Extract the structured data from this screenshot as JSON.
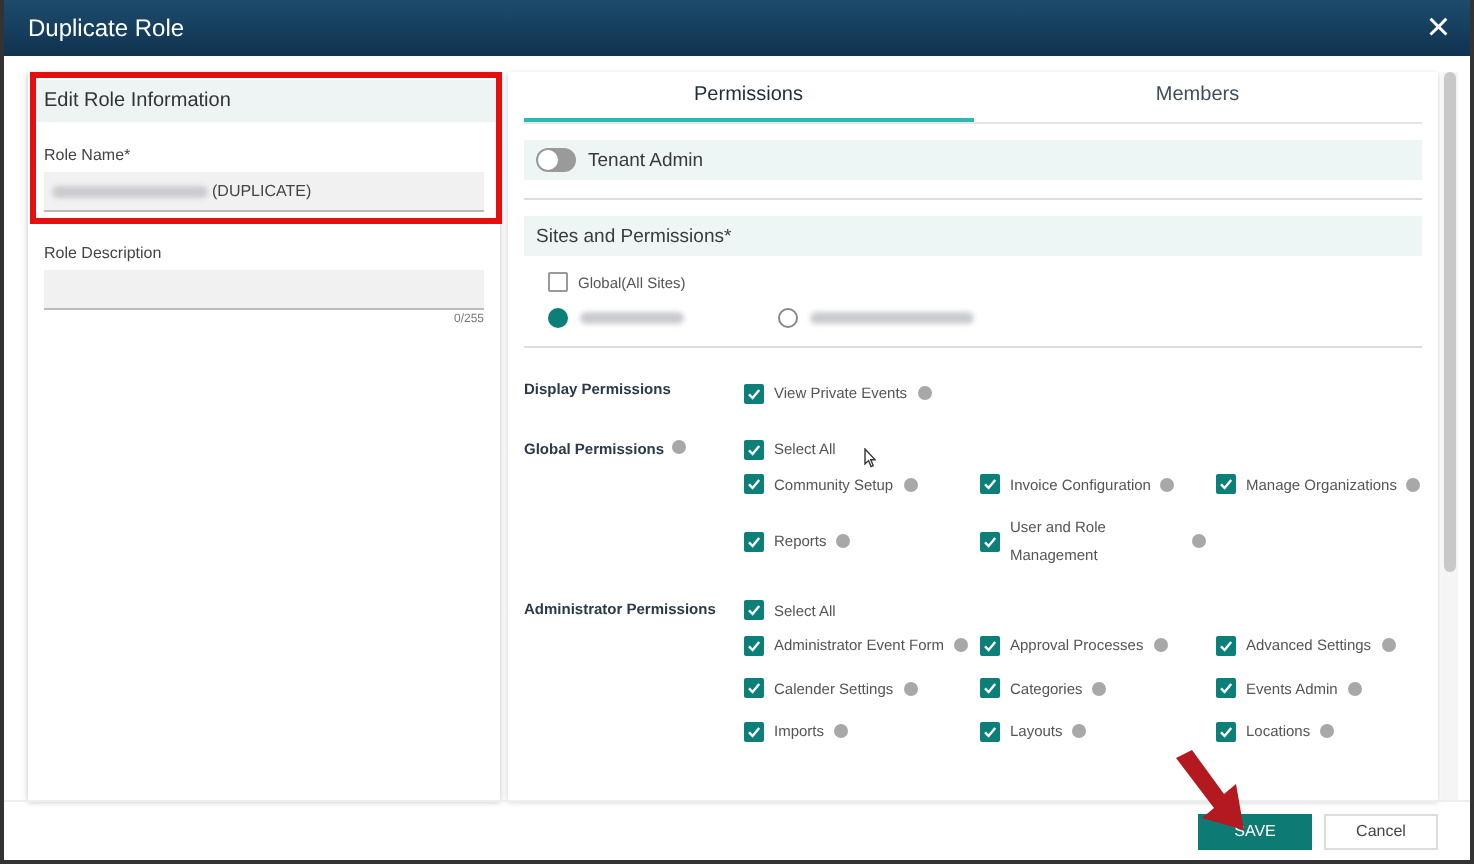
{
  "dialog": {
    "title": "Duplicate Role"
  },
  "role_info": {
    "heading": "Edit Role Information",
    "name_label": "Role Name*",
    "name_value": "(DUPLICATE)",
    "description_label": "Role Description",
    "description_counter": "0/255"
  },
  "tabs": [
    {
      "label": "Permissions",
      "selected": true
    },
    {
      "label": "Members",
      "selected": false
    }
  ],
  "tenant_admin": {
    "label": "Tenant Admin",
    "on": false
  },
  "sites": {
    "heading": "Sites and Permissions*",
    "global": {
      "label": "Global(All Sites)",
      "checked": false
    },
    "options": [
      {
        "selected": true
      },
      {
        "selected": false
      }
    ]
  },
  "permission_groups": [
    {
      "title": "Display Permissions",
      "help": false,
      "items": [
        {
          "label": "View Private Events",
          "checked": true
        }
      ]
    },
    {
      "title": "Global Permissions",
      "help": true,
      "select_all": {
        "label": "Select All",
        "checked": true
      },
      "items": [
        {
          "label": "Community Setup",
          "checked": true
        },
        {
          "label": "Invoice Configuration",
          "checked": true
        },
        {
          "label": "Manage Organizations",
          "checked": true
        },
        {
          "label": "Reports",
          "checked": true
        },
        {
          "label": "User and Role Management",
          "checked": true
        }
      ]
    },
    {
      "title": "Administrator Permissions",
      "help": false,
      "select_all": {
        "label": "Select All",
        "checked": true
      },
      "items": [
        {
          "label": "Administrator Event Form",
          "checked": true
        },
        {
          "label": "Approval Processes",
          "checked": true
        },
        {
          "label": "Advanced Settings",
          "checked": true
        },
        {
          "label": "Calender Settings",
          "checked": true
        },
        {
          "label": "Categories",
          "checked": true
        },
        {
          "label": "Events Admin",
          "checked": true
        },
        {
          "label": "Imports",
          "checked": true
        },
        {
          "label": "Layouts",
          "checked": true
        },
        {
          "label": "Locations",
          "checked": true
        }
      ]
    }
  ],
  "buttons": {
    "save": "SAVE",
    "cancel": "Cancel"
  },
  "close": "×"
}
